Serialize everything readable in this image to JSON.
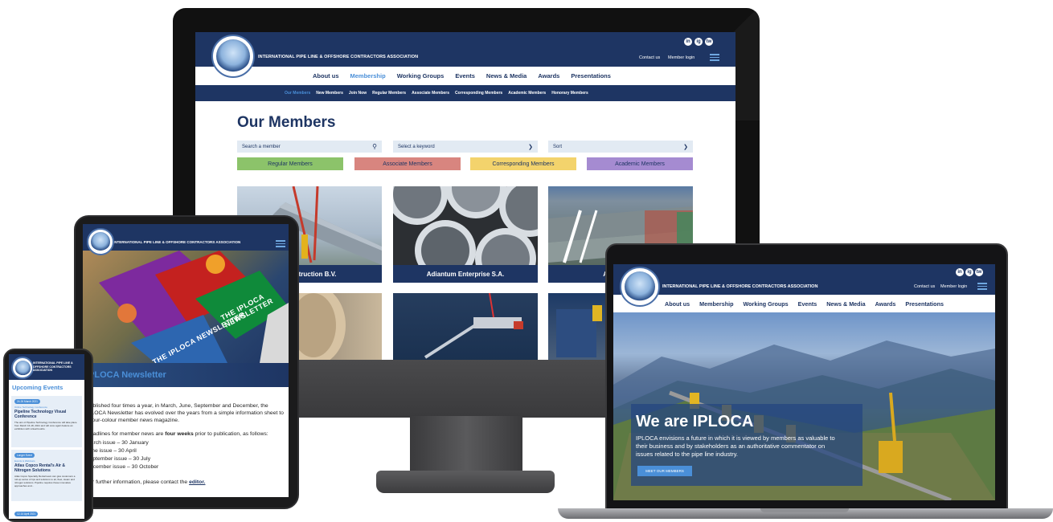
{
  "brand": {
    "name": "INTERNATIONAL PIPE LINE & OFFSHORE CONTRACTORS ASSOCIATION"
  },
  "header": {
    "contact": "Contact us",
    "login": "Member login"
  },
  "social": [
    "in",
    "ig",
    "tw"
  ],
  "nav": {
    "main": [
      "About us",
      "Membership",
      "Working Groups",
      "Events",
      "News & Media",
      "Awards",
      "Presentations"
    ],
    "active": "Membership",
    "sub": [
      "Our Members",
      "New Members",
      "Join Now",
      "Regular Members",
      "Associate Members",
      "Corresponding Members",
      "Academic Members",
      "Honorary Members"
    ]
  },
  "members_page": {
    "title": "Our Members",
    "search_placeholder": "Search a member",
    "keyword_select": "Select a keyword",
    "sort_select": "Sort",
    "filters": [
      "Regular Members",
      "Associate Members",
      "Corresponding Members",
      "Academic Members"
    ],
    "filter_colors": [
      "#8cc36a",
      "#d8857f",
      "#f3d36c",
      "#a58bd1"
    ],
    "tiles": [
      "Construction B.V.",
      "Adiantum Enterprise S.A.",
      "Akzo Nobel"
    ]
  },
  "tablet": {
    "newsletter_title": "IPLOCA Newsletter",
    "card_texts": [
      "THE IPLOCA NEWSLETTER",
      "THE IPLOCA NEWSLETTER"
    ],
    "p1": "Published four times a year, in March, June, September and December, the IPLOCA Newsletter has evolved over the years from a simple information sheet to a four-colour member news magazine.",
    "p2_start": "Deadlines for member news are ",
    "p2_bold": "four weeks",
    "p2_end": " prior to publication, as follows:",
    "deadlines": [
      "March issue – 30 January",
      "June issue – 30 April",
      "September issue – 30 July",
      "December issue – 30 October"
    ],
    "p3_start": "For further information, please contact the ",
    "p3_link": "editor."
  },
  "phone": {
    "brand": "INTERNATIONAL PIPE LINE & OFFSHORE CONTRACTORS ASSOCIATION",
    "section": "Upcoming Events",
    "events": [
      {
        "date": "24-26 March 2021",
        "category": "Online Technology Conference",
        "title": "Pipeline Technology Visual Conference",
        "body": "The aim of Pipeline Technology Conference will take place from March 16-18, 2021 and will once again feature an exhibition with virtual booths."
      },
      {
        "date": "Longer Event",
        "category": "Events & Webinars",
        "title": "Atlas Copco Rental's Air & Nitrogen Solutions",
        "body": "Atlas Copco Specialty Rental team can give customers a roll-up series of tips and solutions to air, fleet, steam and nitrogen solutions. Pipeline requires these innovative approaches and..."
      }
    ],
    "last_date": "12-14 April 2021"
  },
  "laptop": {
    "hero_title": "We are IPLOCA",
    "hero_text": "IPLOCA envisions a future in which it is viewed by members as valuable to their business and by stakeholders as an authoritative commentator on issues related to the pipe line industry.",
    "hero_button": "MEET OUR MEMBERS"
  },
  "colors": {
    "navy": "#1e3563",
    "accent": "#4a8fd8",
    "active_nav": "#4a8fd8"
  }
}
